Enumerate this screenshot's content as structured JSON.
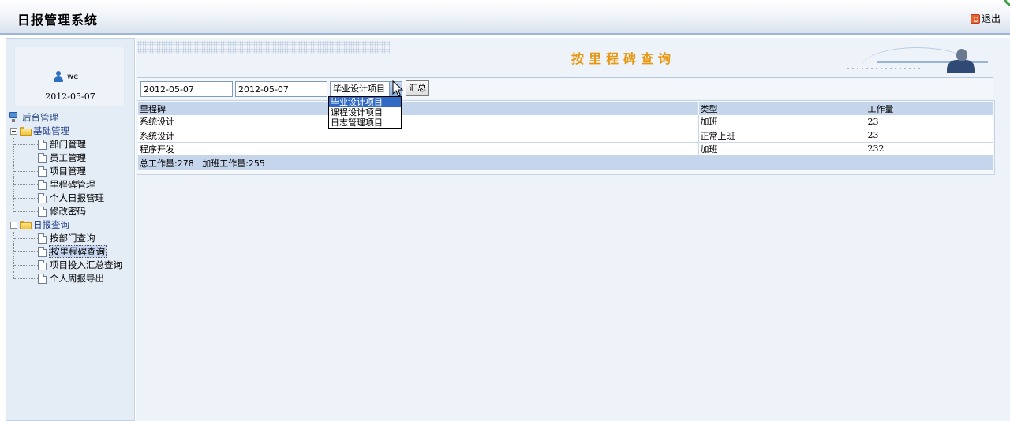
{
  "header": {
    "app_title": "日报管理系统",
    "logout_label": "退出"
  },
  "sidebar": {
    "user_name": "we",
    "login_date": "2012-05-07",
    "root_label": "后台管理",
    "groups": [
      {
        "label": "基础管理",
        "items": [
          "部门管理",
          "员工管理",
          "项目管理",
          "里程碑管理",
          "个人日报管理",
          "修改密码"
        ]
      },
      {
        "label": "日报查询",
        "items": [
          "按部门查询",
          "按里程碑查询",
          "项目投入汇总查询",
          "个人周报导出"
        ]
      }
    ],
    "selected_item": "按里程碑查询"
  },
  "main": {
    "page_title": "按里程碑查询",
    "filter": {
      "start_date": "2012-05-07",
      "end_date": "2012-05-07",
      "project_selected": "毕业设计项目",
      "project_options": [
        "毕业设计项目",
        "课程设计项目",
        "日志管理项目"
      ],
      "sum_button": "汇总"
    },
    "table": {
      "headers": [
        "里程碑",
        "类型",
        "工作量"
      ],
      "rows": [
        [
          "系统设计",
          "加班",
          "23"
        ],
        [
          "系统设计",
          "正常上班",
          "23"
        ],
        [
          "程序开发",
          "加班",
          "232"
        ]
      ],
      "summary": "总工作量:278   加班工作量:255"
    }
  },
  "colors": {
    "title_orange": "#e8960c",
    "header_row": "#c5d5ec",
    "dropdown_highlight": "#316ac5"
  }
}
